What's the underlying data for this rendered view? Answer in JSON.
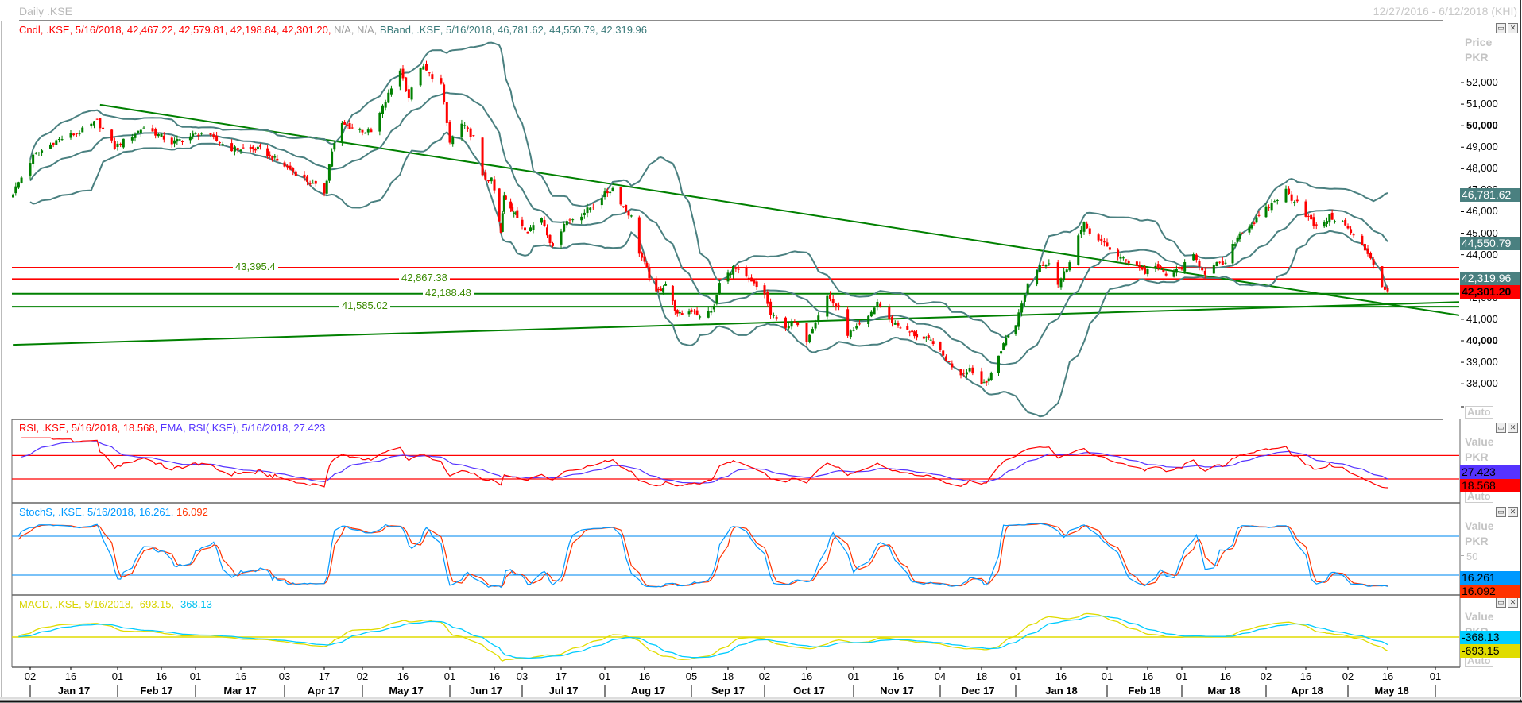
{
  "window": {
    "title": "Daily .KSE",
    "date_range": "12/27/2016 - 6/12/2018 (KHI)"
  },
  "price_panel": {
    "legend": {
      "cndl": "Cndl, .KSE, 5/16/2018, 42,467.22, 42,579.81, 42,198.84, 42,301.20,",
      "na": " N/A, N/A,",
      "bband": " BBand, .KSE, 5/16/2018, 46,781.62, 44,550.79, 42,319.96"
    },
    "axis_title": "Price",
    "axis_unit": "PKR",
    "auto": "Auto",
    "ticks": [
      {
        "value": 52000,
        "label": "52,000",
        "bold": false
      },
      {
        "value": 51000,
        "label": "51,000",
        "bold": false
      },
      {
        "value": 50000,
        "label": "50,000",
        "bold": true
      },
      {
        "value": 49000,
        "label": "49,000",
        "bold": false
      },
      {
        "value": 48000,
        "label": "48,000",
        "bold": false
      },
      {
        "value": 47000,
        "label": "47,000",
        "bold": false
      },
      {
        "value": 46000,
        "label": "46,000",
        "bold": false
      },
      {
        "value": 45000,
        "label": "45,000",
        "bold": false
      },
      {
        "value": 44000,
        "label": "44,000",
        "bold": false
      },
      {
        "value": 43000,
        "label": "43,000",
        "bold": false
      },
      {
        "value": 42000,
        "label": "42,000",
        "bold": false
      },
      {
        "value": 41000,
        "label": "41,000",
        "bold": false
      },
      {
        "value": 40000,
        "label": "40,000",
        "bold": true
      },
      {
        "value": 39000,
        "label": "39,000",
        "bold": false
      },
      {
        "value": 38000,
        "label": "38,000",
        "bold": false
      }
    ],
    "value_boxes": [
      {
        "value": 46781.62,
        "label": "46,781.62",
        "bg": "#4a8080",
        "fg": "#ffffff"
      },
      {
        "value": 44550.79,
        "label": "44,550.79",
        "bg": "#4a8080",
        "fg": "#ffffff"
      },
      {
        "value": 42319.96,
        "label": "42,319.96",
        "bg": "#4a8080",
        "fg": "#ffffff"
      },
      {
        "value": 42301.2,
        "label": "42,301.20",
        "bg": "#ff0000",
        "fg": "#000000"
      }
    ],
    "levels": [
      {
        "value": 43395.4,
        "label": "43,395.4",
        "color": "#ff0000"
      },
      {
        "value": 42867.38,
        "label": "42,867.38",
        "color": "#ff0000"
      },
      {
        "value": 42188.48,
        "label": "42,188.48",
        "color": "#008000"
      },
      {
        "value": 41585.02,
        "label": "41,585.02",
        "color": "#008000"
      }
    ]
  },
  "rsi_panel": {
    "legend": {
      "rsi": "RSI, .KSE, 5/16/2018, 18.568,",
      "ema": " EMA, RSI(.KSE), 5/16/2018, 27.423"
    },
    "axis_title": "Value",
    "axis_unit": "PKR",
    "auto": "Auto",
    "value_boxes": [
      {
        "value": 27.423,
        "label": "27.423",
        "bg": "#5533ff",
        "fg": "#000000"
      },
      {
        "value": 18.568,
        "label": "18.568",
        "bg": "#ff0000",
        "fg": "#000000"
      }
    ],
    "levels": [
      70,
      30
    ]
  },
  "stoch_panel": {
    "legend": {
      "k": "StochS, .KSE, 5/16/2018, 16.261,",
      "d": " 16.092"
    },
    "axis_title": "Value",
    "axis_unit": "PKR",
    "mid_tick": "50",
    "value_boxes": [
      {
        "value": 16.261,
        "label": "16.261",
        "bg": "#0099ff",
        "fg": "#000000"
      },
      {
        "value": 16.092,
        "label": "16.092",
        "bg": "#ff3300",
        "fg": "#000000"
      }
    ],
    "levels": [
      80,
      20
    ]
  },
  "macd_panel": {
    "legend": {
      "macd": "MACD, .KSE, 5/16/2018, -693.15,",
      "signal": " -368.13"
    },
    "axis_title": "Value",
    "axis_unit": "PKR",
    "auto": "Auto",
    "value_boxes": [
      {
        "value": -368.13,
        "label": "-368.13",
        "bg": "#00ccff",
        "fg": "#000000"
      },
      {
        "value": -693.15,
        "label": "-693.15",
        "bg": "#e0dc00",
        "fg": "#000000"
      }
    ]
  },
  "x_axis": {
    "ticks": [
      {
        "label": "02",
        "date": "2017-01-02"
      },
      {
        "label": "16",
        "date": "2017-01-16"
      },
      {
        "label": "01",
        "date": "2017-02-01"
      },
      {
        "label": "16",
        "date": "2017-02-16"
      },
      {
        "label": "01",
        "date": "2017-03-01"
      },
      {
        "label": "16",
        "date": "2017-03-16"
      },
      {
        "label": "03",
        "date": "2017-04-03"
      },
      {
        "label": "17",
        "date": "2017-04-17"
      },
      {
        "label": "02",
        "date": "2017-05-02"
      },
      {
        "label": "16",
        "date": "2017-05-16"
      },
      {
        "label": "01",
        "date": "2017-06-01"
      },
      {
        "label": "16",
        "date": "2017-06-16"
      },
      {
        "label": "03",
        "date": "2017-07-03"
      },
      {
        "label": "17",
        "date": "2017-07-17"
      },
      {
        "label": "01",
        "date": "2017-08-01"
      },
      {
        "label": "16",
        "date": "2017-08-16"
      },
      {
        "label": "05",
        "date": "2017-09-05"
      },
      {
        "label": "18",
        "date": "2017-09-18"
      },
      {
        "label": "02",
        "date": "2017-10-02"
      },
      {
        "label": "16",
        "date": "2017-10-16"
      },
      {
        "label": "01",
        "date": "2017-11-01"
      },
      {
        "label": "16",
        "date": "2017-11-16"
      },
      {
        "label": "04",
        "date": "2017-12-04"
      },
      {
        "label": "18",
        "date": "2017-12-18"
      },
      {
        "label": "01",
        "date": "2018-01-01"
      },
      {
        "label": "16",
        "date": "2018-01-16"
      },
      {
        "label": "01",
        "date": "2018-02-01"
      },
      {
        "label": "16",
        "date": "2018-02-16"
      },
      {
        "label": "01",
        "date": "2018-03-01"
      },
      {
        "label": "16",
        "date": "2018-03-16"
      },
      {
        "label": "02",
        "date": "2018-04-02"
      },
      {
        "label": "16",
        "date": "2018-04-16"
      },
      {
        "label": "02",
        "date": "2018-05-02"
      },
      {
        "label": "16",
        "date": "2018-05-16"
      },
      {
        "label": "01",
        "date": "2018-06-01"
      }
    ],
    "months": [
      "Jan 17",
      "Feb 17",
      "Mar 17",
      "Apr 17",
      "May 17",
      "Jun 17",
      "Jul 17",
      "Aug 17",
      "Sep 17",
      "Oct 17",
      "Nov 17",
      "Dec 17",
      "Jan 18",
      "Feb 18",
      "Mar 18",
      "Apr 18",
      "May 18"
    ]
  },
  "chart_data": {
    "type": "candlestick",
    "title": "Daily .KSE",
    "ylabel": "Price PKR",
    "ylim": [
      37500,
      53000
    ],
    "colors": {
      "up": "#008000",
      "down": "#ff0000",
      "bband": "#4a8080",
      "rsi": "#ff0000",
      "rsi_ema": "#5533ff",
      "stoch_k": "#0099ff",
      "stoch_d": "#ff3300",
      "macd": "#e0dc00",
      "signal": "#00ccff",
      "trend": "#008000"
    },
    "last_candle": {
      "date": "2018-05-16",
      "open": 42467.22,
      "high": 42579.81,
      "low": 42198.84,
      "close": 42301.2
    },
    "close_anchors": [
      [
        "2016-12-27",
        46870
      ],
      [
        "2017-01-03",
        48570
      ],
      [
        "2017-01-11",
        49300
      ],
      [
        "2017-01-19",
        49700
      ],
      [
        "2017-01-25",
        50200
      ],
      [
        "2017-01-31",
        49000
      ],
      [
        "2017-02-10",
        49930
      ],
      [
        "2017-02-20",
        49200
      ],
      [
        "2017-03-03",
        49670
      ],
      [
        "2017-03-13",
        48930
      ],
      [
        "2017-03-24",
        48900
      ],
      [
        "2017-04-05",
        47970
      ],
      [
        "2017-04-17",
        46900
      ],
      [
        "2017-04-20",
        48830
      ],
      [
        "2017-04-24",
        50050
      ],
      [
        "2017-05-05",
        49670
      ],
      [
        "2017-05-15",
        52620
      ],
      [
        "2017-05-18",
        51300
      ],
      [
        "2017-05-22",
        52780
      ],
      [
        "2017-05-29",
        51900
      ],
      [
        "2017-06-01",
        49200
      ],
      [
        "2017-06-05",
        50060
      ],
      [
        "2017-06-09",
        49450
      ],
      [
        "2017-06-12",
        47600
      ],
      [
        "2017-06-15",
        47460
      ],
      [
        "2017-06-20",
        45000
      ],
      [
        "2017-06-22",
        46720
      ],
      [
        "2017-07-05",
        45130
      ],
      [
        "2017-07-10",
        45750
      ],
      [
        "2017-07-14",
        44280
      ],
      [
        "2017-07-18",
        45500
      ],
      [
        "2017-07-24",
        45870
      ],
      [
        "2017-07-28",
        46300
      ],
      [
        "2017-07-31",
        46720
      ],
      [
        "2017-08-04",
        47090
      ],
      [
        "2017-08-08",
        46240
      ],
      [
        "2017-08-11",
        45750
      ],
      [
        "2017-08-14",
        44130
      ],
      [
        "2017-08-17",
        43290
      ],
      [
        "2017-08-21",
        42180
      ],
      [
        "2017-08-25",
        42660
      ],
      [
        "2017-08-30",
        41180
      ],
      [
        "2017-09-06",
        41440
      ],
      [
        "2017-09-08",
        41070
      ],
      [
        "2017-09-13",
        41550
      ],
      [
        "2017-09-15",
        42660
      ],
      [
        "2017-09-20",
        43400
      ],
      [
        "2017-09-26",
        42800
      ],
      [
        "2017-10-02",
        42180
      ],
      [
        "2017-10-04",
        41180
      ],
      [
        "2017-10-09",
        40700
      ],
      [
        "2017-10-12",
        40810
      ],
      [
        "2017-10-16",
        40070
      ],
      [
        "2017-10-19",
        40960
      ],
      [
        "2017-10-23",
        42070
      ],
      [
        "2017-10-27",
        41440
      ],
      [
        "2017-10-30",
        40330
      ],
      [
        "2017-11-01",
        40440
      ],
      [
        "2017-11-06",
        41070
      ],
      [
        "2017-11-09",
        41810
      ],
      [
        "2017-11-13",
        40960
      ],
      [
        "2017-11-20",
        40440
      ],
      [
        "2017-11-27",
        40070
      ],
      [
        "2017-12-01",
        39960
      ],
      [
        "2017-12-07",
        38960
      ],
      [
        "2017-12-11",
        38480
      ],
      [
        "2017-12-14",
        38740
      ],
      [
        "2017-12-18",
        38000
      ],
      [
        "2017-12-22",
        38370
      ],
      [
        "2017-12-27",
        39900
      ],
      [
        "2018-01-01",
        40810
      ],
      [
        "2018-01-03",
        41700
      ],
      [
        "2018-01-05",
        42660
      ],
      [
        "2018-01-09",
        43550
      ],
      [
        "2018-01-12",
        43660
      ],
      [
        "2018-01-15",
        42660
      ],
      [
        "2018-01-18",
        43400
      ],
      [
        "2018-01-22",
        44880
      ],
      [
        "2018-01-24",
        45390
      ],
      [
        "2018-01-29",
        44650
      ],
      [
        "2018-02-02",
        44280
      ],
      [
        "2018-02-07",
        43770
      ],
      [
        "2018-02-12",
        43550
      ],
      [
        "2018-02-15",
        43170
      ],
      [
        "2018-02-19",
        43550
      ],
      [
        "2018-02-23",
        43030
      ],
      [
        "2018-02-28",
        43290
      ],
      [
        "2018-03-05",
        43910
      ],
      [
        "2018-03-09",
        43170
      ],
      [
        "2018-03-13",
        43550
      ],
      [
        "2018-03-16",
        43550
      ],
      [
        "2018-03-19",
        44390
      ],
      [
        "2018-03-22",
        45010
      ],
      [
        "2018-03-28",
        45500
      ],
      [
        "2018-04-05",
        46500
      ],
      [
        "2018-04-09",
        46980
      ],
      [
        "2018-04-11",
        46610
      ],
      [
        "2018-04-13",
        46500
      ],
      [
        "2018-04-16",
        45870
      ],
      [
        "2018-04-20",
        45250
      ],
      [
        "2018-04-25",
        45760
      ],
      [
        "2018-04-30",
        45500
      ],
      [
        "2018-05-03",
        45020
      ],
      [
        "2018-05-07",
        44390
      ],
      [
        "2018-05-10",
        43910
      ],
      [
        "2018-05-11",
        43540
      ],
      [
        "2018-05-14",
        42550
      ],
      [
        "2018-05-16",
        42301.2
      ]
    ],
    "trendlines": [
      {
        "name": "descending",
        "from": [
          "2017-01-26",
          50970
        ],
        "to": [
          "2018-05-16",
          41700
        ]
      },
      {
        "name": "ascending",
        "from": [
          "2016-12-27",
          39810
        ],
        "to": [
          "2018-05-16",
          41700
        ]
      }
    ],
    "indicators": {
      "bband": {
        "period": 20,
        "stddev": 2
      },
      "rsi": {
        "period": 14,
        "ema": 14
      },
      "stoch": {
        "k": 14,
        "slow": 3,
        "d": 3
      },
      "macd": {
        "fast": 12,
        "slow": 26,
        "signal": 9
      }
    }
  }
}
